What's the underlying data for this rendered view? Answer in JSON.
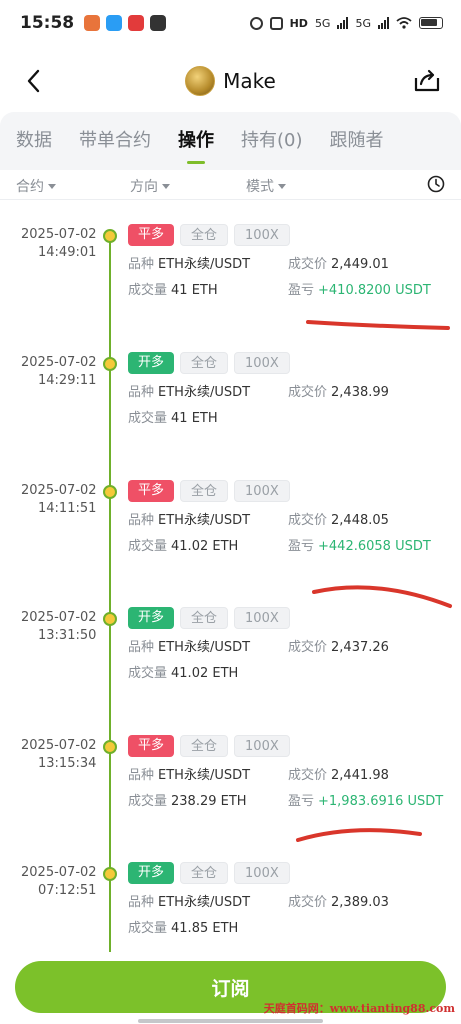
{
  "status": {
    "time": "15:58",
    "network1": "5G",
    "network2": "5G",
    "hd": "HD"
  },
  "header": {
    "title": "Make"
  },
  "tabs": [
    {
      "label": "数据",
      "active": false
    },
    {
      "label": "带单合约",
      "active": false
    },
    {
      "label": "操作",
      "active": true
    },
    {
      "label": "持有(0)",
      "active": false
    },
    {
      "label": "跟随者",
      "active": false
    }
  ],
  "filters": {
    "contract": "合约",
    "direction": "方向",
    "mode": "模式"
  },
  "labels": {
    "symbol": "品种",
    "price": "成交价",
    "volume": "成交量",
    "pnl": "盈亏"
  },
  "records": [
    {
      "date": "2025-07-02",
      "time": "14:49:01",
      "action": "平多",
      "type": "close",
      "margin": "全仓",
      "leverage": "100X",
      "symbol": "ETH永续/USDT",
      "price": "2,449.01",
      "volume": "41 ETH",
      "pnl": "+410.8200 USDT"
    },
    {
      "date": "2025-07-02",
      "time": "14:29:11",
      "action": "开多",
      "type": "open",
      "margin": "全仓",
      "leverage": "100X",
      "symbol": "ETH永续/USDT",
      "price": "2,438.99",
      "volume": "41 ETH",
      "pnl": ""
    },
    {
      "date": "2025-07-02",
      "time": "14:11:51",
      "action": "平多",
      "type": "close",
      "margin": "全仓",
      "leverage": "100X",
      "symbol": "ETH永续/USDT",
      "price": "2,448.05",
      "volume": "41.02 ETH",
      "pnl": "+442.6058 USDT"
    },
    {
      "date": "2025-07-02",
      "time": "13:31:50",
      "action": "开多",
      "type": "open",
      "margin": "全仓",
      "leverage": "100X",
      "symbol": "ETH永续/USDT",
      "price": "2,437.26",
      "volume": "41.02 ETH",
      "pnl": ""
    },
    {
      "date": "2025-07-02",
      "time": "13:15:34",
      "action": "平多",
      "type": "close",
      "margin": "全仓",
      "leverage": "100X",
      "symbol": "ETH永续/USDT",
      "price": "2,441.98",
      "volume": "238.29 ETH",
      "pnl": "+1,983.6916 USDT"
    },
    {
      "date": "2025-07-02",
      "time": "07:12:51",
      "action": "开多",
      "type": "open",
      "margin": "全仓",
      "leverage": "100X",
      "symbol": "ETH永续/USDT",
      "price": "2,389.03",
      "volume": "41.85 ETH",
      "pnl": ""
    }
  ],
  "subscribe_label": "订阅",
  "watermark": "天庭首码网：www.tianting88.com",
  "colors": {
    "accent": "#7cc12a",
    "open": "#2cb573",
    "close": "#ef5066",
    "profit": "#2cb573"
  }
}
